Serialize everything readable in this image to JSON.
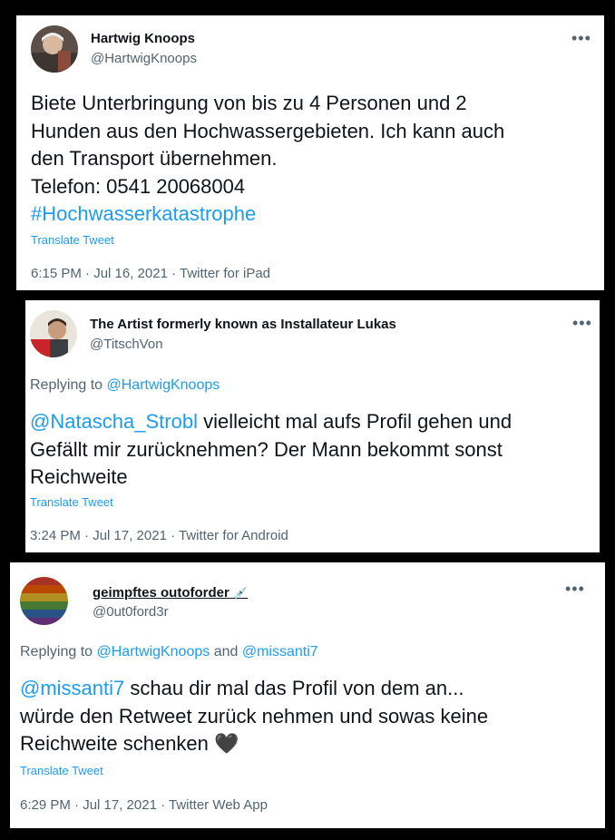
{
  "tweets": [
    {
      "name": "Hartwig Knoops",
      "handle": "@HartwigKnoops",
      "more": "•••",
      "text_lines": [
        "Biete Unterbringung von bis zu 4 Personen und 2",
        "Hunden aus den Hochwassergebieten. Ich kann auch",
        "den Transport übernehmen.",
        "Telefon: 0541 20068004"
      ],
      "hashtag": "#Hochwasserkatastrophe",
      "translate": "Translate Tweet",
      "time": "6:15 PM · Jul 16, 2021 · ",
      "source": "Twitter for iPad"
    },
    {
      "name": "The Artist formerly known as Installateur Lukas",
      "handle": "@TitschVon",
      "more": "•••",
      "replying_prefix": "Replying to ",
      "replying_to": "@HartwigKnoops",
      "mention": "@Natascha_Strobl",
      "text_line1_rest": " vielleicht mal aufs Profil gehen und",
      "text_line2": "Gefällt mir zurücknehmen? Der Mann bekommt sonst",
      "text_line3": "Reichweite",
      "translate": "Translate Tweet",
      "time": "3:24 PM · Jul 17, 2021 · ",
      "source": "Twitter for Android"
    },
    {
      "name": "geimpftes outoforder",
      "name_emoji": "💉",
      "handle": "@0ut0ford3r",
      "more": "•••",
      "replying_prefix": "Replying to ",
      "replying_to_1": "@HartwigKnoops",
      "replying_and": " and ",
      "replying_to_2": "@missanti7",
      "mention": "@missanti7",
      "text_line1_rest": " schau dir mal das Profil von dem an...",
      "text_line2": "würde den Retweet zurück nehmen und sowas keine",
      "text_line3": "Reichweite schenken ",
      "heart": "🖤",
      "translate": "Translate Tweet",
      "time": "6:29 PM · Jul 17, 2021 · ",
      "source": "Twitter Web App"
    }
  ]
}
